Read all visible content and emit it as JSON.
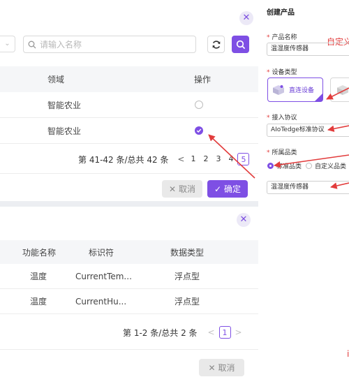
{
  "colors": {
    "accent": "#7e4fe4",
    "annotation": "#e23c3c",
    "header_bg": "#f5f6f8"
  },
  "product_list": {
    "search": {
      "placeholder": "请输入名称",
      "icon": "search-icon"
    },
    "columns": {
      "domain": "领域",
      "action": "操作"
    },
    "rows": [
      {
        "domain": "智能农业",
        "selected": false
      },
      {
        "domain": "智能农业",
        "selected": true
      }
    ],
    "pager": {
      "summary": "第 41-42 条/总共 42 条",
      "prev": "<",
      "pages": [
        "1",
        "2",
        "3",
        "4",
        "5"
      ],
      "active": "5"
    },
    "cancel_label": "取消",
    "confirm_label": "确定"
  },
  "function_list": {
    "columns": {
      "name": "功能名称",
      "identifier": "标识符",
      "data_type": "数据类型"
    },
    "rows": [
      {
        "name": "温度",
        "identifier": "CurrentTem...",
        "data_type": "浮点型"
      },
      {
        "name": "温度",
        "identifier": "CurrentHu...",
        "data_type": "浮点型"
      }
    ],
    "pager": {
      "summary": "第 1-2 条/总共 2 条",
      "prev": "<",
      "page": "1",
      "next": ">"
    },
    "cancel_label": "取消"
  },
  "create_product": {
    "title": "创建产品",
    "name_label": "产品名称",
    "name_value": "温湿度传感器",
    "name_annotation": "自定义",
    "device_type_label": "设备类型",
    "device_type_selected": "直连设备",
    "protocol_label": "接入协议",
    "protocol_value": "AIoTedge标准协议",
    "category_label": "所属品类",
    "category_options": [
      "标准品类",
      "自定义品类"
    ],
    "category_value": "温湿度传感器",
    "bottom_annotation": "i"
  }
}
